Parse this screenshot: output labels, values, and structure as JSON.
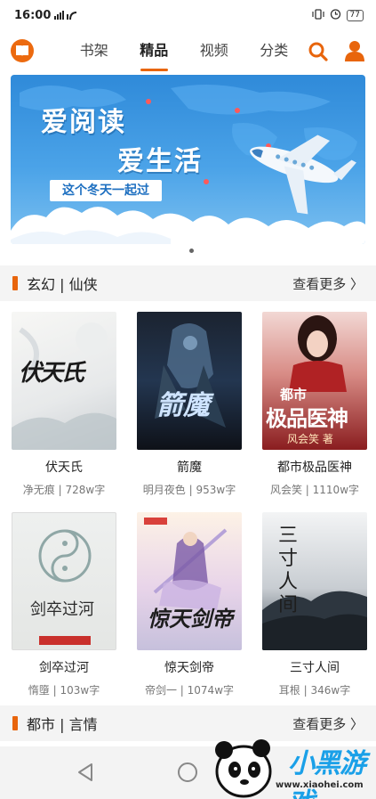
{
  "status_bar": {
    "time": "16:00",
    "signal": "ᵗ⸳ıl",
    "right_icons": "▣ ⏰",
    "battery": "77"
  },
  "nav": {
    "tabs": [
      {
        "label": "书架"
      },
      {
        "label": "精品"
      },
      {
        "label": "视频"
      },
      {
        "label": "分类"
      }
    ],
    "active_tab": 1,
    "accent_color": "#e8650c"
  },
  "banner": {
    "line1": "爱阅读",
    "line2": "爱生活",
    "tagline": "这个冬天一起过",
    "page_indicator": "1 of 1"
  },
  "sections": [
    {
      "title": "玄幻 | 仙侠",
      "more": "查看更多 〉",
      "books": [
        {
          "cover_text": "伏天氏",
          "name": "伏天氏",
          "meta": "净无痕 | 728w字"
        },
        {
          "cover_text": "箭魔",
          "name": "箭魔",
          "meta": "明月夜色 | 953w字"
        },
        {
          "cover_text": "极品医神",
          "cover_top": "都市",
          "cover_author": "风会笑 著",
          "name": "都市极品医神",
          "meta": "风会笑 | 1110w字"
        },
        {
          "cover_text": "剑卒过河",
          "name": "剑卒过河",
          "meta": "惰墮 | 103w字"
        },
        {
          "cover_text": "惊天剑帝",
          "name": "惊天剑帝",
          "meta": "帝剑一 | 1074w字"
        },
        {
          "cover_text": "三寸人间",
          "name": "三寸人间",
          "meta": "耳根 | 346w字"
        }
      ]
    },
    {
      "title": "都市 | 言情",
      "more": "查看更多 〉"
    }
  ],
  "watermark": {
    "title": "小黑游戏",
    "url": "www.xiaohei.com"
  }
}
